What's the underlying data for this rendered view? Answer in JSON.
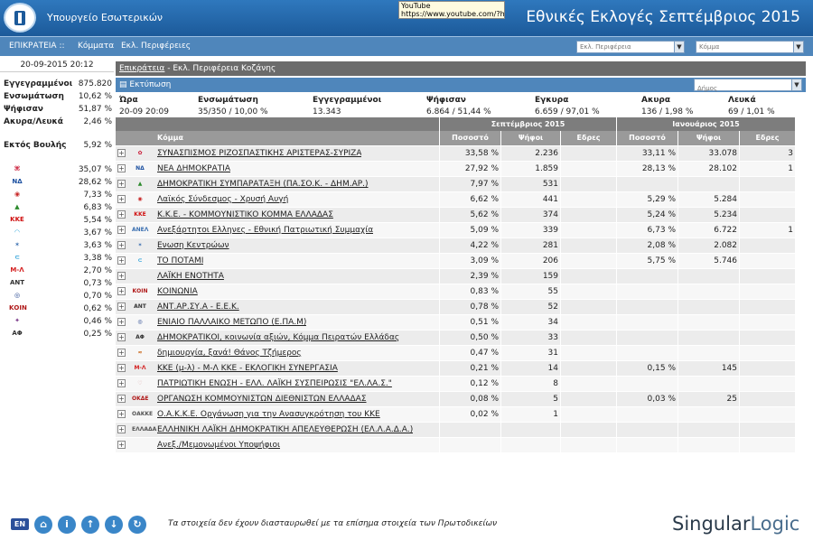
{
  "header": {
    "ministry": "Υπουργείο Εσωτερικών",
    "title": "Εθνικές Εκλογές Σεπτέμβριος 2015",
    "tooltip_line1": "YouTube",
    "tooltip_line2": "https://www.youtube.com/?hl=el"
  },
  "nav": {
    "level": "ΕΠΙΚΡΑΤΕΙΑ ::",
    "parties": "Κόμματα",
    "regions": "Εκλ. Περιφέρειες",
    "select_region": "Εκλ. Περιφέρεια",
    "select_party": "Κόμμα"
  },
  "left": {
    "datetime": "20-09-2015 20:12",
    "stats": [
      {
        "label": "Εγγεγραμμένοι",
        "value": "875.820"
      },
      {
        "label": "Ενσωμάτωση",
        "value": "10,62 %"
      },
      {
        "label": "Ψήφισαν",
        "value": "51,87 %"
      },
      {
        "label": "Ακυρα/Λευκά",
        "value": "2,46 %"
      }
    ],
    "outside": {
      "label": "Εκτός Βουλής",
      "value": "5,92 %"
    },
    "parties": [
      "35,07 %",
      "28,62 %",
      "7,33 %",
      "6,83 %",
      "5,54 %",
      "3,67 %",
      "3,63 %",
      "3,38 %",
      "2,70 %",
      "0,73 %",
      "0,70 %",
      "0,62 %",
      "0,46 %",
      "0,25 %"
    ]
  },
  "breadcrumb": {
    "link": "Επικράτεια",
    "rest": " - Εκλ. Περιφέρεια Κοζάνης"
  },
  "printbar": {
    "print": "Εκτύπωση",
    "select_municipality": "Δήμος"
  },
  "summary": {
    "headers": [
      "Ώρα",
      "Ενσωμάτωση",
      "Εγγεγραμμένοι",
      "Ψήφισαν",
      "Εγκυρα",
      "Ακυρα",
      "Λευκά"
    ],
    "values": [
      "20-09 20:09",
      "35/350 / 10,00 %",
      "13.343",
      "6.864 / 51,44 %",
      "6.659 / 97,01 %",
      "136 / 1,98 %",
      "69 / 1,01 %"
    ]
  },
  "table": {
    "group_sept": "Σεπτέμβριος 2015",
    "group_jan": "Ιανουάριος 2015",
    "col_party": "Κόμμα",
    "col_pct": "Ποσοστό",
    "col_votes": "Ψήφοι",
    "col_seats": "Εδρες",
    "rows": [
      {
        "name": "ΣΥΝΑΣΠΙΣΜΟΣ ΡΙΖΟΣΠΑΣΤΙΚΗΣ ΑΡΙΣΤΕΡΑΣ-ΣΥΡΙΖΑ",
        "pct": "33,58 %",
        "votes": "2.236",
        "seats": "",
        "jpct": "33,11 %",
        "jvotes": "33.078",
        "jseats": "3"
      },
      {
        "name": "ΝΕΑ ΔΗΜΟΚΡΑΤΙΑ",
        "pct": "27,92 %",
        "votes": "1.859",
        "seats": "",
        "jpct": "28,13 %",
        "jvotes": "28.102",
        "jseats": "1"
      },
      {
        "name": "ΔΗΜΟΚΡΑΤΙΚΗ ΣΥΜΠΑΡΑΤΑΞΗ (ΠΑ.ΣΟ.Κ. - ΔΗΜ.ΑΡ.)",
        "pct": "7,97 %",
        "votes": "531",
        "seats": "",
        "jpct": "",
        "jvotes": "",
        "jseats": ""
      },
      {
        "name": "Λαϊκός Σύνδεσμος - Χρυσή Αυγή",
        "pct": "6,62 %",
        "votes": "441",
        "seats": "",
        "jpct": "5,29 %",
        "jvotes": "5.284",
        "jseats": ""
      },
      {
        "name": "Κ.Κ.Ε. - ΚΟΜΜΟΥΝΙΣΤΙΚΟ ΚΟΜΜΑ ΕΛΛΑΔΑΣ",
        "pct": "5,62 %",
        "votes": "374",
        "seats": "",
        "jpct": "5,24 %",
        "jvotes": "5.234",
        "jseats": ""
      },
      {
        "name": "Ανεξάρτητοι Ελληνες - Εθνική Πατριωτική Συμμαχία",
        "pct": "5,09 %",
        "votes": "339",
        "seats": "",
        "jpct": "6,73 %",
        "jvotes": "6.722",
        "jseats": "1"
      },
      {
        "name": "Ενωση Κεντρώων",
        "pct": "4,22 %",
        "votes": "281",
        "seats": "",
        "jpct": "2,08 %",
        "jvotes": "2.082",
        "jseats": ""
      },
      {
        "name": "ΤΟ ΠΟΤΑΜΙ",
        "pct": "3,09 %",
        "votes": "206",
        "seats": "",
        "jpct": "5,75 %",
        "jvotes": "5.746",
        "jseats": ""
      },
      {
        "name": "ΛΑΪΚΗ ΕΝΟΤΗΤΑ",
        "pct": "2,39 %",
        "votes": "159",
        "seats": "",
        "jpct": "",
        "jvotes": "",
        "jseats": ""
      },
      {
        "name": "ΚΟΙΝΩΝΙΑ",
        "pct": "0,83 %",
        "votes": "55",
        "seats": "",
        "jpct": "",
        "jvotes": "",
        "jseats": ""
      },
      {
        "name": "ΑΝΤ.ΑΡ.ΣΥ.Α - Ε.Ε.Κ.",
        "pct": "0,78 %",
        "votes": "52",
        "seats": "",
        "jpct": "",
        "jvotes": "",
        "jseats": ""
      },
      {
        "name": "ΕΝΙΑΙΟ ΠΑΛΛΑΙΚΟ ΜΕΤΩΠΟ (Ε.ΠΑ.Μ)",
        "pct": "0,51 %",
        "votes": "34",
        "seats": "",
        "jpct": "",
        "jvotes": "",
        "jseats": ""
      },
      {
        "name": "ΔΗΜΟΚΡΑΤΙΚΟΙ, κοινωνία αξιών, Κόμμα Πειρατών Ελλάδας",
        "pct": "0,50 %",
        "votes": "33",
        "seats": "",
        "jpct": "",
        "jvotes": "",
        "jseats": ""
      },
      {
        "name": "δημιουργία, ξανά! Θάνος Τζήμερος",
        "pct": "0,47 %",
        "votes": "31",
        "seats": "",
        "jpct": "",
        "jvotes": "",
        "jseats": ""
      },
      {
        "name": "ΚΚΕ (μ-λ) - Μ-Λ ΚΚΕ - ΕΚΛΟΓΙΚΗ ΣΥΝΕΡΓΑΣΙΑ",
        "pct": "0,21 %",
        "votes": "14",
        "seats": "",
        "jpct": "0,15 %",
        "jvotes": "145",
        "jseats": ""
      },
      {
        "name": "ΠΑΤΡΙΩΤΙΚΗ ΕΝΩΣΗ - ΕΛΛ. ΛΑΪΚΗ ΣΥΣΠΕΙΡΩΣΙΣ \"ΕΛ.ΛΑ.Σ.\"",
        "pct": "0,12 %",
        "votes": "8",
        "seats": "",
        "jpct": "",
        "jvotes": "",
        "jseats": ""
      },
      {
        "name": "ΟΡΓΑΝΩΣΗ ΚΟΜΜΟΥΝΙΣΤΩΝ ΔΙΕΘΝΙΣΤΩΝ ΕΛΛΑΔΑΣ",
        "pct": "0,08 %",
        "votes": "5",
        "seats": "",
        "jpct": "0,03 %",
        "jvotes": "25",
        "jseats": ""
      },
      {
        "name": "Ο.Α.Κ.Κ.Ε. Οργάνωση για την Ανασυγκρότηση του ΚΚΕ",
        "pct": "0,02 %",
        "votes": "1",
        "seats": "",
        "jpct": "",
        "jvotes": "",
        "jseats": ""
      },
      {
        "name": "ΕΛΛΗΝΙΚΗ ΛΑΪΚΗ ΔΗΜΟΚΡΑΤΙΚΗ ΑΠΕΛΕΥΘΕΡΩΣΗ (ΕΛ.Λ.Α.Δ.Α.)",
        "pct": "",
        "votes": "",
        "seats": "",
        "jpct": "",
        "jvotes": "",
        "jseats": ""
      },
      {
        "name": "Ανεξ./Μεμονωμένοι Υποψήφιοι",
        "pct": "",
        "votes": "",
        "seats": "",
        "jpct": "",
        "jvotes": "",
        "jseats": ""
      }
    ]
  },
  "footer": {
    "disclaimer": "Τα στοιχεία δεν έχουν διασταυρωθεί με τα επίσημα στοιχεία των Πρωτοδικείων",
    "brand_a": "Singular",
    "brand_b": "Logic"
  }
}
